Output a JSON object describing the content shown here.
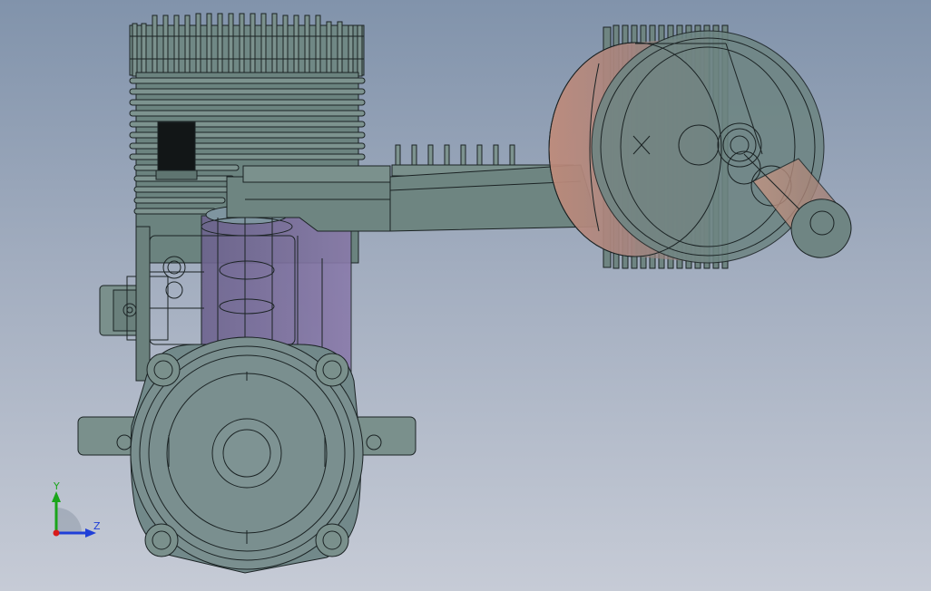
{
  "viewport": {
    "background_top": "#8193ab",
    "background_bottom": "#c6cbd6",
    "part_fill": "#6f8782",
    "edge_color": "#1b2324",
    "liner_color": "#7e6d9a",
    "piston_color": "#b88a7a"
  },
  "triad": {
    "y_label": "Y",
    "z_label": "Z",
    "y_color": "#1aa51a",
    "z_color": "#1f3fd8",
    "origin_color": "#d81a1a"
  }
}
